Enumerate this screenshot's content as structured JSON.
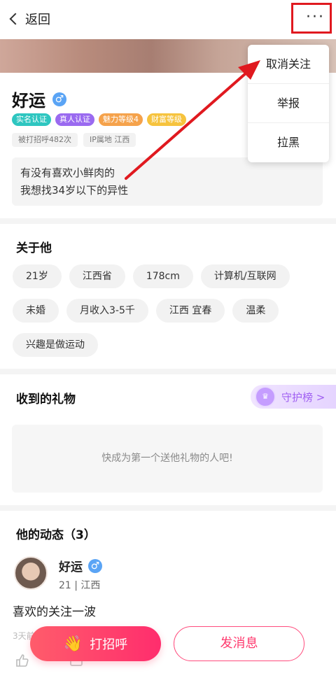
{
  "header": {
    "back_label": "返回",
    "more_label": "···"
  },
  "profile": {
    "name": "好运",
    "gender_symbol": "♂",
    "badges": [
      "实名认证",
      "真人认证",
      "魅力等级4",
      "财富等级"
    ],
    "stats": [
      "被打招呼482次",
      "IP属地 江西"
    ],
    "bio_lines": [
      "有没有喜欢小鲜肉的",
      "我想找34岁以下的异性"
    ]
  },
  "about": {
    "title": "关于他",
    "chips": [
      "21岁",
      "江西省",
      "178cm",
      "计算机/互联网",
      "未婚",
      "月收入3-5千",
      "江西 宜春",
      "温柔",
      "兴趣是做运动"
    ]
  },
  "gifts": {
    "title": "收到的礼物",
    "guard_label": "守护榜 >",
    "empty_text": "快成为第一个送他礼物的人吧!"
  },
  "posts": {
    "title": "他的动态（3）",
    "author": "好运",
    "meta": "21 | 江西",
    "text": "喜欢的关注一波",
    "time": "3天前"
  },
  "actions": {
    "greet_label": "打招呼",
    "message_label": "发消息"
  },
  "menu": {
    "items": [
      "取消关注",
      "举报",
      "拉黑"
    ]
  },
  "colors": {
    "accent": "#ff2d6d",
    "highlight": "#e0191f",
    "guard": "#a05ff2"
  }
}
